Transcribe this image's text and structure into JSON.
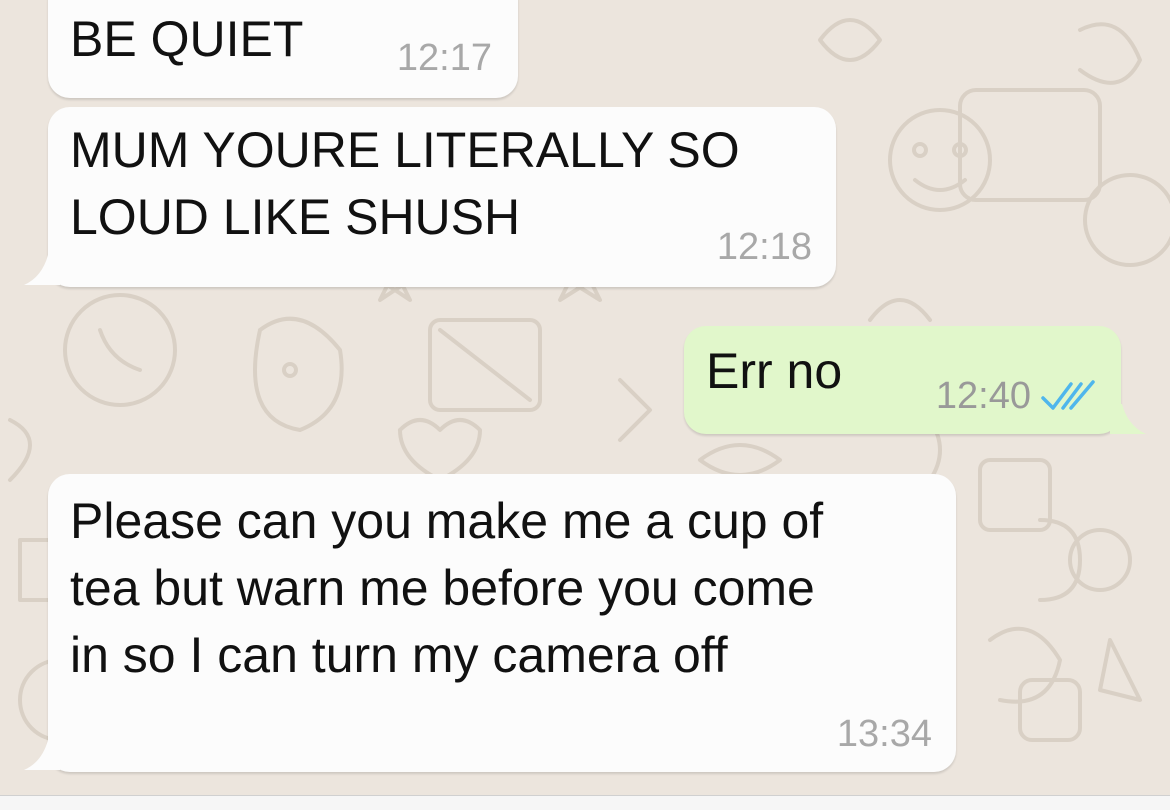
{
  "messages": [
    {
      "direction": "incoming",
      "text": "BE QUIET",
      "time": "12:17"
    },
    {
      "direction": "incoming",
      "text": "MUM YOURE LITERALLY SO\nLOUD LIKE SHUSH",
      "time": "12:18"
    },
    {
      "direction": "outgoing",
      "text": "Err no",
      "time": "12:40",
      "status_icon": "double-check-read-icon"
    },
    {
      "direction": "incoming",
      "text": "Please can you make me a cup of\ntea but warn me before you come\nin so I can turn my camera off",
      "time": "13:34"
    }
  ],
  "colors": {
    "background": "#ece5dd",
    "incoming_bubble": "#fcfcfc",
    "outgoing_bubble": "#e1f7cb",
    "read_ticks": "#4fb6ec",
    "timestamp": "#a8a8a8"
  }
}
